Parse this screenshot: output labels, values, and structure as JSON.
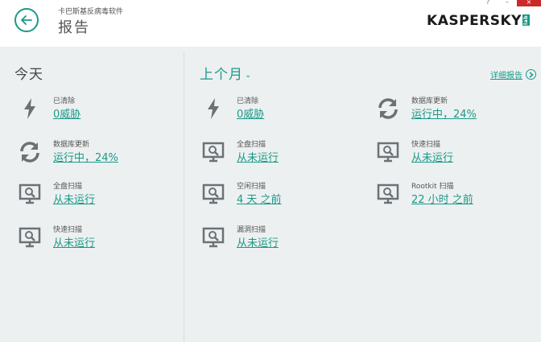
{
  "header": {
    "subtitle": "卡巴斯基反病毒软件",
    "title": "报告",
    "logo_text": "KASPERSKY",
    "logo_suffix": "lab",
    "window_controls": [
      "?",
      "–",
      "×"
    ]
  },
  "today": {
    "title": "今天",
    "items": [
      {
        "icon": "lightning-icon",
        "label": "已清除",
        "value": "0威胁"
      },
      {
        "icon": "refresh-icon",
        "label": "数据库更新",
        "value": "运行中，24%"
      },
      {
        "icon": "monitor-scan-icon",
        "label": "全盘扫描",
        "value": "从未运行"
      },
      {
        "icon": "monitor-scan-icon",
        "label": "快速扫描",
        "value": "从未运行"
      }
    ]
  },
  "last_month": {
    "title": "上个月",
    "detail_link": "详细报告",
    "items": [
      {
        "icon": "lightning-icon",
        "label": "已清除",
        "value": "0威胁"
      },
      {
        "icon": "monitor-scan-icon",
        "label": "全盘扫描",
        "value": "从未运行"
      },
      {
        "icon": "monitor-scan-icon",
        "label": "空闲扫描",
        "value": "4 天 之前"
      },
      {
        "icon": "monitor-scan-icon",
        "label": "漏洞扫描",
        "value": "从未运行"
      },
      {
        "icon": "refresh-icon",
        "label": "数据库更新",
        "value": "运行中，24%"
      },
      {
        "icon": "monitor-scan-icon",
        "label": "快速扫描",
        "value": "从未运行"
      },
      {
        "icon": "monitor-scan-icon",
        "label": "Rootkit 扫描",
        "value": "22 小时 之前"
      }
    ]
  },
  "colors": {
    "accent": "#1a9a88",
    "background": "#edf0f1",
    "close": "#cc2a2a"
  }
}
